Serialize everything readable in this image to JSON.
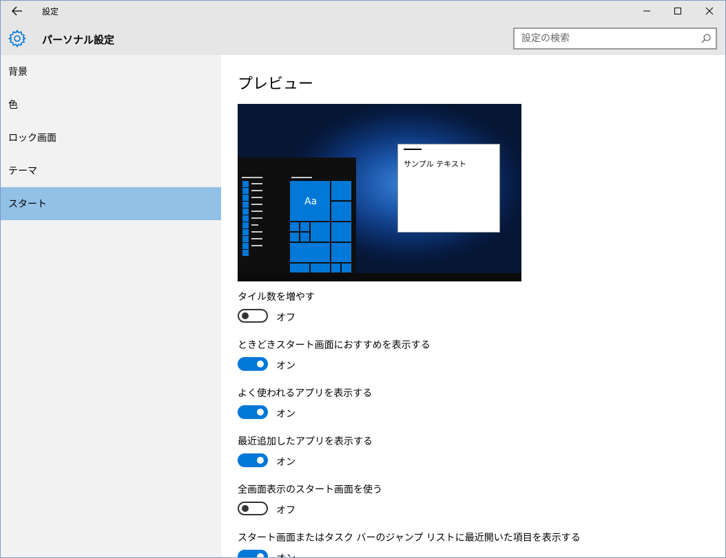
{
  "window": {
    "title": "設定"
  },
  "header": {
    "title": "パーソナル設定",
    "search_placeholder": "設定の検索"
  },
  "sidebar": {
    "items": [
      {
        "label": "背景",
        "active": false
      },
      {
        "label": "色",
        "active": false
      },
      {
        "label": "ロック画面",
        "active": false
      },
      {
        "label": "テーマ",
        "active": false
      },
      {
        "label": "スタート",
        "active": true
      }
    ]
  },
  "main": {
    "section_title": "プレビュー",
    "preview": {
      "window_text": "サンプル テキスト",
      "tile_text": "Aa"
    },
    "settings": [
      {
        "label": "タイル数を増やす",
        "state": "オフ",
        "on": false
      },
      {
        "label": "ときどきスタート画面におすすめを表示する",
        "state": "オン",
        "on": true
      },
      {
        "label": "よく使われるアプリを表示する",
        "state": "オン",
        "on": true
      },
      {
        "label": "最近追加したアプリを表示する",
        "state": "オン",
        "on": true
      },
      {
        "label": "全画面表示のスタート画面を使う",
        "state": "オフ",
        "on": false
      },
      {
        "label": "スタート画面またはタスク バーのジャンプ リストに最近開いた項目を表示する",
        "state": "オン",
        "on": true
      }
    ]
  },
  "colors": {
    "accent": "#0078d7",
    "sidebar_active": "#93c0e6",
    "chrome": "#e6e6e6",
    "sidebar": "#f2f2f2"
  }
}
